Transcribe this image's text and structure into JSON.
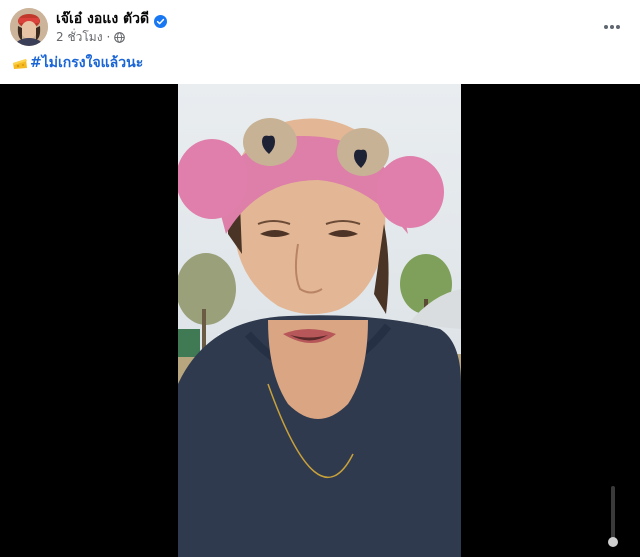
{
  "post": {
    "author_name": "เจ๊เอ๋ งอแง ตัวดี",
    "timestamp": "2 ชั่วโมง",
    "separator": "·",
    "caption_hashtag": "#ไม่เกรงใจแล้วนะ"
  },
  "icons": {
    "verified": "verified-badge-icon",
    "audience": "globe-icon",
    "more": "more-options-icon",
    "caption_emoji": "cheese-emoji-icon",
    "volume": "volume-slider-icon"
  },
  "colors": {
    "verified_blue": "#1877f2",
    "link_blue": "#1b66d6",
    "meta_gray": "#65676b",
    "video_background": "#000000"
  }
}
